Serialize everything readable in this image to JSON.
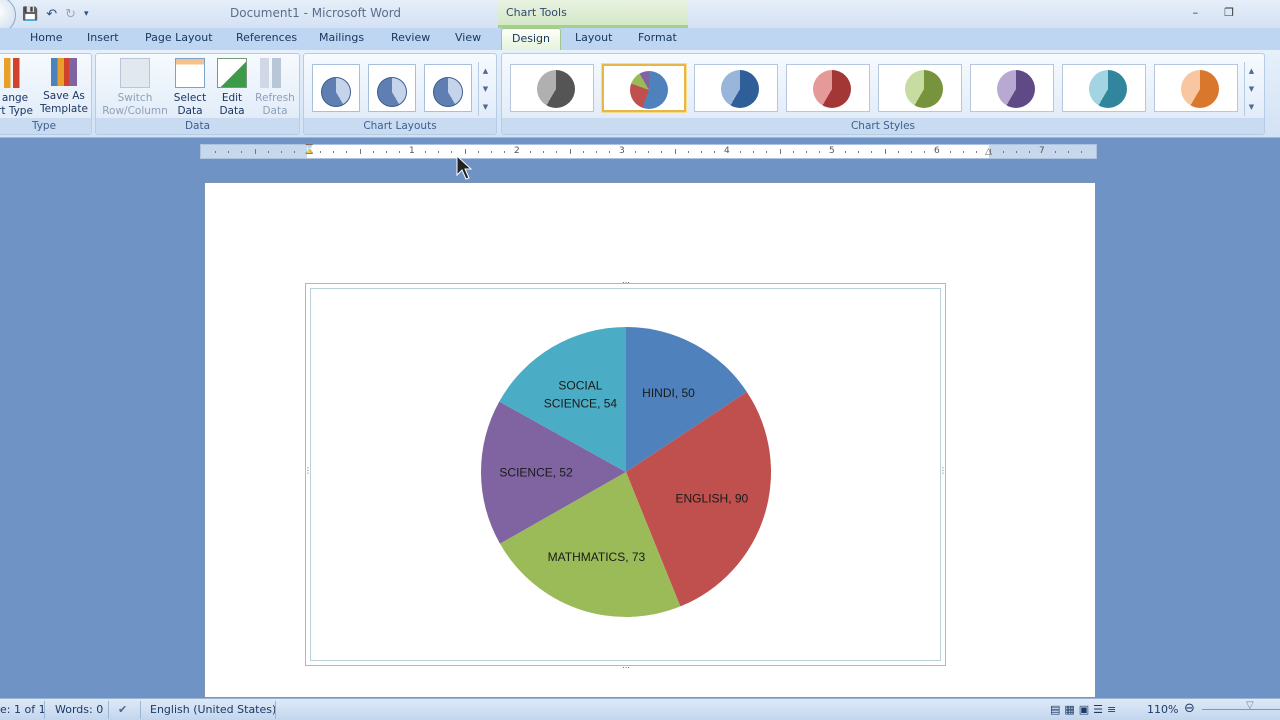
{
  "window": {
    "title": "Document1 - Microsoft Word",
    "context_tab": "Chart Tools"
  },
  "quick_access": [
    "save-icon",
    "undo-icon",
    "redo-icon",
    "customize-icon"
  ],
  "tabs": [
    "Home",
    "Insert",
    "Page Layout",
    "References",
    "Mailings",
    "Review",
    "View"
  ],
  "context_tabs": [
    "Design",
    "Layout",
    "Format"
  ],
  "active_tab": "Design",
  "ribbon": {
    "type_group": {
      "label": "Type",
      "change_chart_type": "ange\nrt Type",
      "save_as_template": "Save As\nTemplate"
    },
    "data_group": {
      "label": "Data",
      "switch": "Switch\nRow/Column",
      "select": "Select\nData",
      "edit": "Edit\nData",
      "refresh": "Refresh\nData"
    },
    "layouts_group": {
      "label": "Chart Layouts"
    },
    "styles_group": {
      "label": "Chart Styles",
      "selected_index": 1,
      "styles": [
        {
          "a": "#555555",
          "b": "#b0b0b0"
        },
        {
          "a": "#4f81bd",
          "b": "#c0504d"
        },
        {
          "a": "#2f5f98",
          "b": "#9ab5da"
        },
        {
          "a": "#a23735",
          "b": "#e49a98"
        },
        {
          "a": "#77933c",
          "b": "#c7dca0"
        },
        {
          "a": "#5f4a86",
          "b": "#b8a9d2"
        },
        {
          "a": "#31859c",
          "b": "#a3d4e2"
        },
        {
          "a": "#d9772c",
          "b": "#f8c6a0"
        }
      ]
    }
  },
  "ruler": {
    "numbers": [
      "1",
      "1",
      "2",
      "3",
      "4",
      "5",
      "6",
      "7"
    ]
  },
  "chart_data": {
    "type": "pie",
    "title": "",
    "categories": [
      "HINDI",
      "ENGLISH",
      "MATHMATICS",
      "SCIENCE",
      "SOCIAL SCIENCE"
    ],
    "values": [
      50,
      90,
      73,
      52,
      54
    ],
    "colors": [
      "#4f81bd",
      "#c0504d",
      "#9bbb59",
      "#8064a2",
      "#4bacc6"
    ],
    "labels": [
      "HINDI, 50",
      "ENGLISH, 90",
      "MATHMATICS, 73",
      "SCIENCE, 52",
      "SOCIAL SCIENCE, 54"
    ],
    "legend": "none"
  },
  "status": {
    "page": "e: 1 of 1",
    "words": "Words: 0",
    "language": "English (United States)",
    "zoom": "110%"
  }
}
